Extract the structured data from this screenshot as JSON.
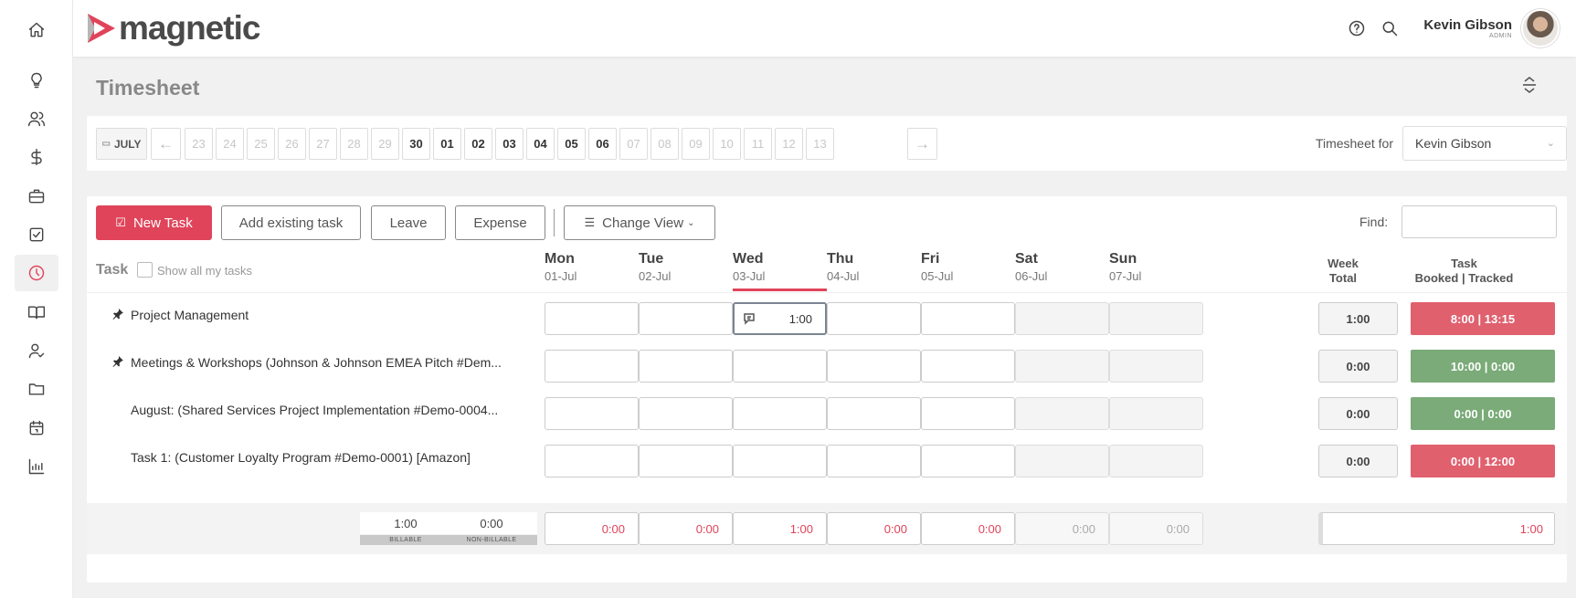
{
  "brand": {
    "name": "magnetic",
    "accent": "#e0445a"
  },
  "sidebar": {
    "items": [
      {
        "icon": "home-icon"
      },
      {
        "icon": "lightbulb-icon"
      },
      {
        "icon": "users-icon"
      },
      {
        "icon": "dollar-icon"
      },
      {
        "icon": "briefcase-icon"
      },
      {
        "icon": "task-check-icon"
      },
      {
        "icon": "clock-icon",
        "active": true
      },
      {
        "icon": "book-icon"
      },
      {
        "icon": "user-check-icon"
      },
      {
        "icon": "folder-icon"
      },
      {
        "icon": "calendar-icon"
      },
      {
        "icon": "chart-icon"
      }
    ]
  },
  "header": {
    "user_name": "Kevin Gibson",
    "user_role": "ADMIN"
  },
  "page": {
    "title": "Timesheet"
  },
  "datebar": {
    "month": "JULY",
    "days": [
      "23",
      "24",
      "25",
      "26",
      "27",
      "28",
      "29",
      "30",
      "01",
      "02",
      "03",
      "04",
      "05",
      "06",
      "07",
      "08",
      "09",
      "10",
      "11",
      "12",
      "13"
    ],
    "active_days": [
      "30",
      "01",
      "02",
      "03",
      "04",
      "05",
      "06"
    ],
    "timesheet_for_label": "Timesheet for",
    "timesheet_for_value": "Kevin Gibson"
  },
  "toolbar": {
    "new_task": "New Task",
    "add_existing": "Add existing task",
    "leave": "Leave",
    "expense": "Expense",
    "change_view": "Change View",
    "find_label": "Find:"
  },
  "grid": {
    "task_header": "Task",
    "show_all": "Show all my tasks",
    "days": [
      {
        "name": "Mon",
        "date": "01-Jul"
      },
      {
        "name": "Tue",
        "date": "02-Jul"
      },
      {
        "name": "Wed",
        "date": "03-Jul",
        "today": true
      },
      {
        "name": "Thu",
        "date": "04-Jul"
      },
      {
        "name": "Fri",
        "date": "05-Jul"
      },
      {
        "name": "Sat",
        "date": "06-Jul",
        "weekend": true
      },
      {
        "name": "Sun",
        "date": "07-Jul",
        "weekend": true
      }
    ],
    "week_total_header": [
      "Week",
      "Total"
    ],
    "booked_header": [
      "Task",
      "Booked | Tracked"
    ],
    "rows": [
      {
        "name": "Project Management",
        "pinned": true,
        "entries": [
          "",
          "",
          "1:00",
          "",
          "",
          "",
          ""
        ],
        "week_total": "1:00",
        "booked": "8:00 | 13:15",
        "status": "over"
      },
      {
        "name": "Meetings & Workshops (Johnson & Johnson EMEA Pitch #Dem...",
        "pinned": true,
        "entries": [
          "",
          "",
          "",
          "",
          "",
          "",
          ""
        ],
        "week_total": "0:00",
        "booked": "10:00 | 0:00",
        "status": "ok"
      },
      {
        "name": "August: (Shared Services Project Implementation #Demo-0004...",
        "pinned": false,
        "entries": [
          "",
          "",
          "",
          "",
          "",
          "",
          ""
        ],
        "week_total": "0:00",
        "booked": "0:00 | 0:00",
        "status": "ok"
      },
      {
        "name": "Task 1: (Customer Loyalty Program #Demo-0001) [Amazon]",
        "pinned": false,
        "entries": [
          "",
          "",
          "",
          "",
          "",
          "",
          ""
        ],
        "week_total": "0:00",
        "booked": "0:00 | 12:00",
        "status": "over"
      }
    ],
    "summary": {
      "billable_value": "1:00",
      "billable_label": "BILLABLE",
      "non_billable_value": "0:00",
      "non_billable_label": "NON-BILLABLE",
      "day_totals": [
        "0:00",
        "0:00",
        "1:00",
        "0:00",
        "0:00",
        "0:00",
        "0:00"
      ],
      "grand_total": "1:00"
    },
    "colors": {
      "over": "#e0606e",
      "ok": "#7aab78"
    }
  }
}
